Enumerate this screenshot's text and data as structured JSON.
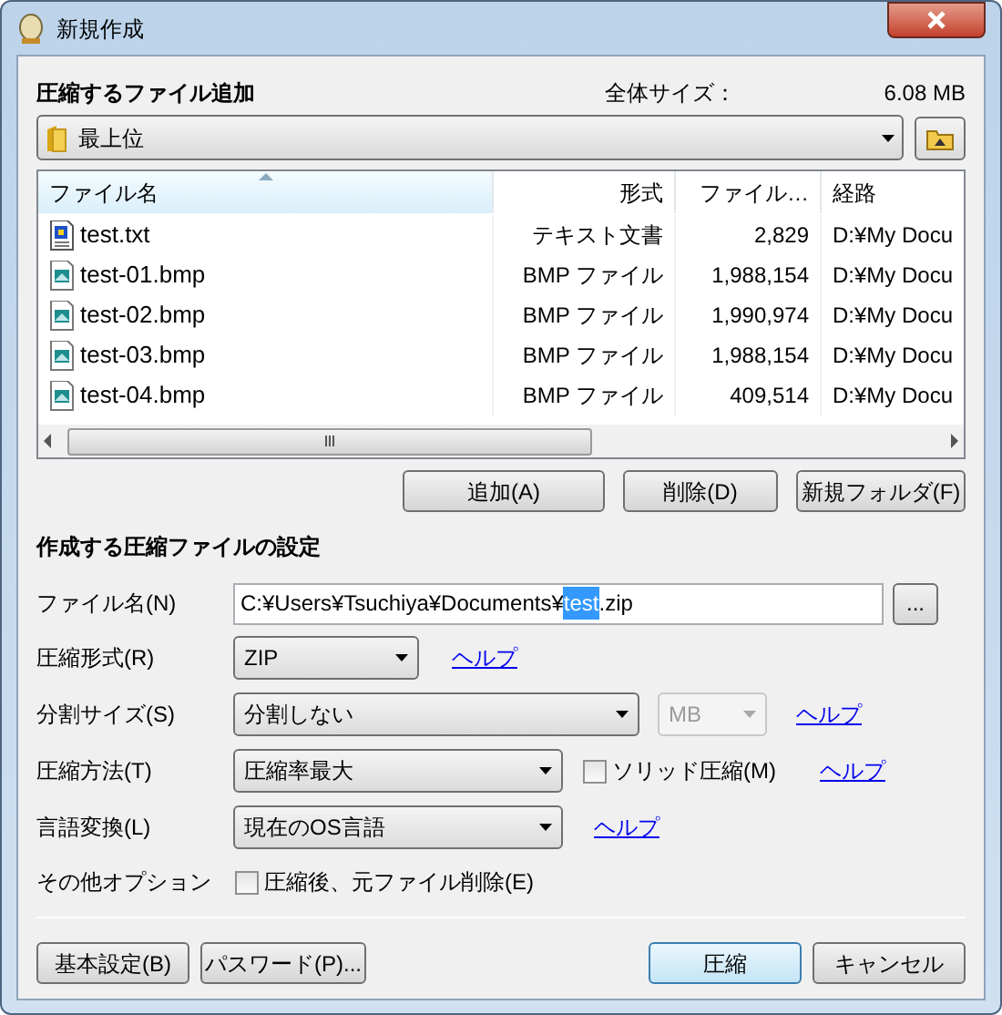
{
  "window": {
    "title": "新規作成"
  },
  "files_section": {
    "heading": "圧縮するファイル追加",
    "total_label": "全体サイズ：",
    "total_value": "6.08 MB",
    "folder": "最上位"
  },
  "file_list": {
    "columns": [
      {
        "label": "ファイル名",
        "sorted": true
      },
      {
        "label": "形式",
        "sorted": false
      },
      {
        "label": "ファイル…",
        "sorted": false
      },
      {
        "label": "経路",
        "sorted": false
      }
    ],
    "rows": [
      {
        "kind": "text",
        "name": "test.txt",
        "type": "テキスト文書",
        "size": "2,829",
        "path": "D:¥My Docu"
      },
      {
        "kind": "image",
        "name": "test-01.bmp",
        "type": "BMP ファイル",
        "size": "1,988,154",
        "path": "D:¥My Docu"
      },
      {
        "kind": "image",
        "name": "test-02.bmp",
        "type": "BMP ファイル",
        "size": "1,990,974",
        "path": "D:¥My Docu"
      },
      {
        "kind": "image",
        "name": "test-03.bmp",
        "type": "BMP ファイル",
        "size": "1,988,154",
        "path": "D:¥My Docu"
      },
      {
        "kind": "image",
        "name": "test-04.bmp",
        "type": "BMP ファイル",
        "size": "409,514",
        "path": "D:¥My Docu"
      }
    ]
  },
  "list_buttons": [
    "追加(A)",
    "削除(D)",
    "新規フォルダ(F)"
  ],
  "settings": {
    "heading": "作成する圧縮ファイルの設定",
    "filename": {
      "label": "ファイル名(N)",
      "value_before": "C:¥Users¥Tsuchiya¥Documents¥",
      "value_selected": "test",
      "value_after": ".zip",
      "browse": "..."
    },
    "format": {
      "label": "圧縮形式(R)",
      "value": "ZIP",
      "help": "ヘルプ"
    },
    "split": {
      "label": "分割サイズ(S)",
      "value": "分割しない",
      "unit": "MB",
      "unit_disabled": true,
      "help": "ヘルプ"
    },
    "method": {
      "label": "圧縮方法(T)",
      "value": "圧縮率最大",
      "solid_label": "ソリッド圧縮(M)",
      "solid_checked": false,
      "help": "ヘルプ"
    },
    "language": {
      "label": "言語変換(L)",
      "value": "現在のOS言語",
      "help": "ヘルプ"
    },
    "other": {
      "label": "その他オプション",
      "delete_label": "圧縮後、元ファイル削除(E)",
      "delete_checked": false
    }
  },
  "footer_buttons": [
    {
      "label": "基本設定(B)",
      "default": false
    },
    {
      "label": "パスワード(P)...",
      "default": false
    },
    {
      "label": "圧縮",
      "default": true
    },
    {
      "label": "キャンセル",
      "default": false
    }
  ]
}
